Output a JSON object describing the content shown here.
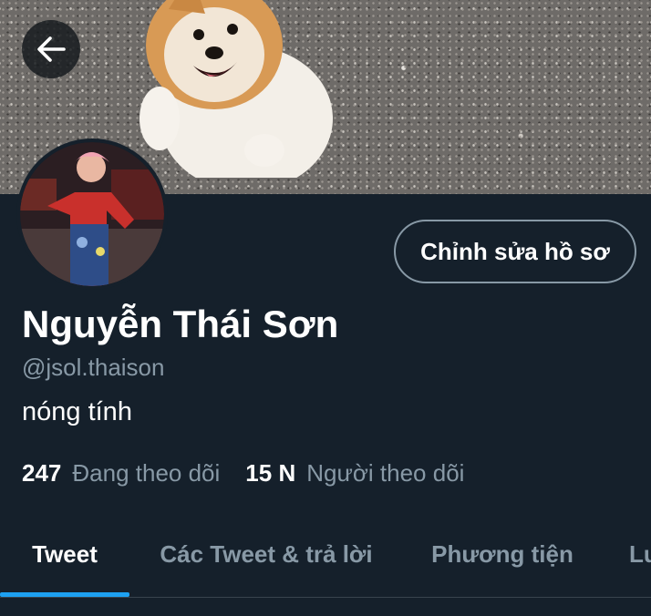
{
  "header": {
    "back_label": "Back"
  },
  "profile": {
    "edit_button": "Chỉnh sửa hồ sơ",
    "name": "Nguyễn Thái Sơn",
    "handle": "@jsol.thaison",
    "bio": "nóng tính",
    "following_count": "247",
    "following_label": "Đang theo dõi",
    "followers_count": "15 N",
    "followers_label": "Người theo dõi"
  },
  "tabs": [
    {
      "label": "Tweet",
      "active": true
    },
    {
      "label": "Các Tweet & trả lời",
      "active": false
    },
    {
      "label": "Phương tiện",
      "active": false
    },
    {
      "label": "Lư",
      "active": false
    }
  ],
  "colors": {
    "background": "#15202b",
    "accent": "#1da1f2",
    "secondary_text": "#8899a6"
  },
  "icons": {
    "back": "arrow-left-icon"
  }
}
